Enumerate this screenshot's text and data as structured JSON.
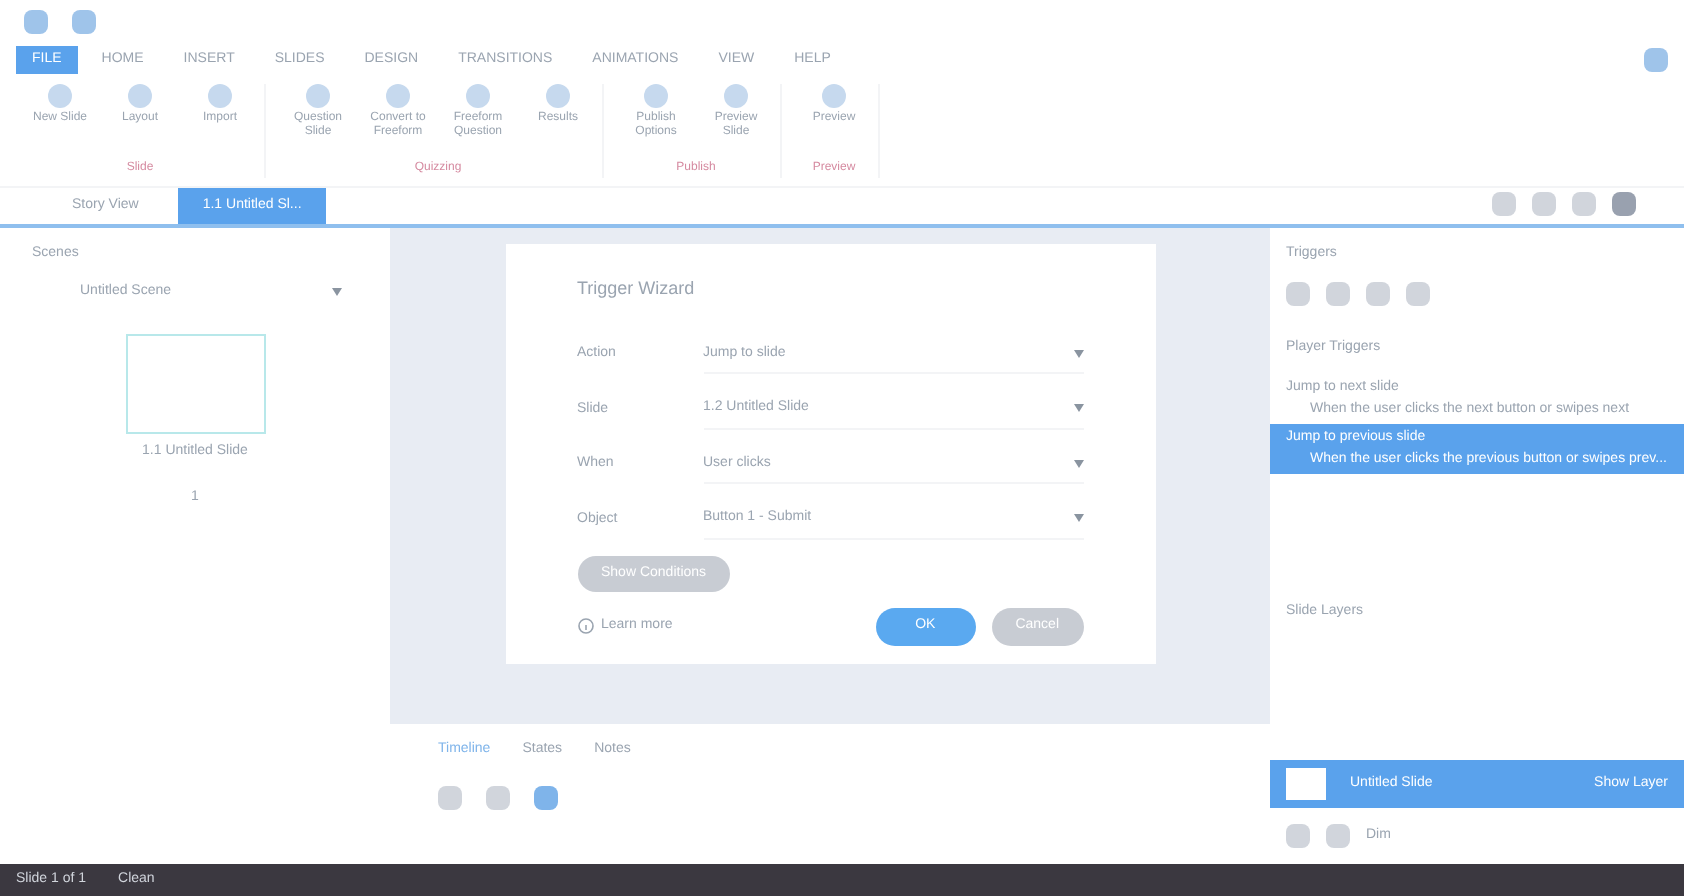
{
  "ribbon_tabs": [
    {
      "label": "FILE",
      "selected": true
    },
    {
      "label": "HOME",
      "selected": false
    },
    {
      "label": "INSERT",
      "selected": false
    },
    {
      "label": "SLIDES",
      "selected": false
    },
    {
      "label": "DESIGN",
      "selected": false
    },
    {
      "label": "TRANSITIONS",
      "selected": false
    },
    {
      "label": "ANIMATIONS",
      "selected": false
    },
    {
      "label": "VIEW",
      "selected": false
    },
    {
      "label": "HELP",
      "selected": false
    }
  ],
  "ribbon_groups": [
    {
      "label": "Slide",
      "buttons": [
        "New Slide",
        "Layout",
        "Import"
      ]
    },
    {
      "label": "Quizzing",
      "buttons": [
        "Question Slide",
        "Convert to Freeform",
        "Freeform Question",
        "Results"
      ]
    },
    {
      "label": "Publish",
      "buttons": [
        "Publish Options",
        "Preview Slide"
      ]
    },
    {
      "label": "Preview",
      "buttons": [
        "Preview"
      ]
    }
  ],
  "doc_tabs": [
    {
      "label": "Story View",
      "selected": false
    },
    {
      "label": "1.1 Untitled Sl...",
      "selected": true
    }
  ],
  "scenes": {
    "title": "Scenes",
    "scene": "Untitled Scene",
    "slide": "1.1 Untitled Slide",
    "slide_number": "1"
  },
  "dialog": {
    "title": "Trigger Wizard",
    "fields": [
      {
        "label": "Action",
        "value": "Jump to slide"
      },
      {
        "label": "Slide",
        "value": "1.2 Untitled Slide"
      },
      {
        "label": "When",
        "value": "User clicks"
      },
      {
        "label": "Object",
        "value": "Button 1 - Submit"
      }
    ],
    "conditions": "Show Conditions",
    "learn_more": "Learn more",
    "ok": "OK",
    "cancel": "Cancel"
  },
  "bottom_tabs": [
    {
      "label": "Timeline",
      "selected": true
    },
    {
      "label": "States",
      "selected": false
    },
    {
      "label": "Notes",
      "selected": false
    }
  ],
  "triggers": {
    "title": "Triggers",
    "section": "Player Triggers",
    "items": [
      {
        "action": "Jump to next slide",
        "when": "When the user clicks the next button or swipes next",
        "selected": false
      },
      {
        "action": "Jump to previous slide",
        "when": "When the user clicks the previous button or swipes prev...",
        "selected": true
      }
    ]
  },
  "layers": {
    "title": "Slide Layers",
    "base": "Untitled Slide",
    "show": "Show Layer",
    "dim": "Dim"
  },
  "status_bar": {
    "slide": "Slide 1 of 1",
    "state": "Clean"
  }
}
